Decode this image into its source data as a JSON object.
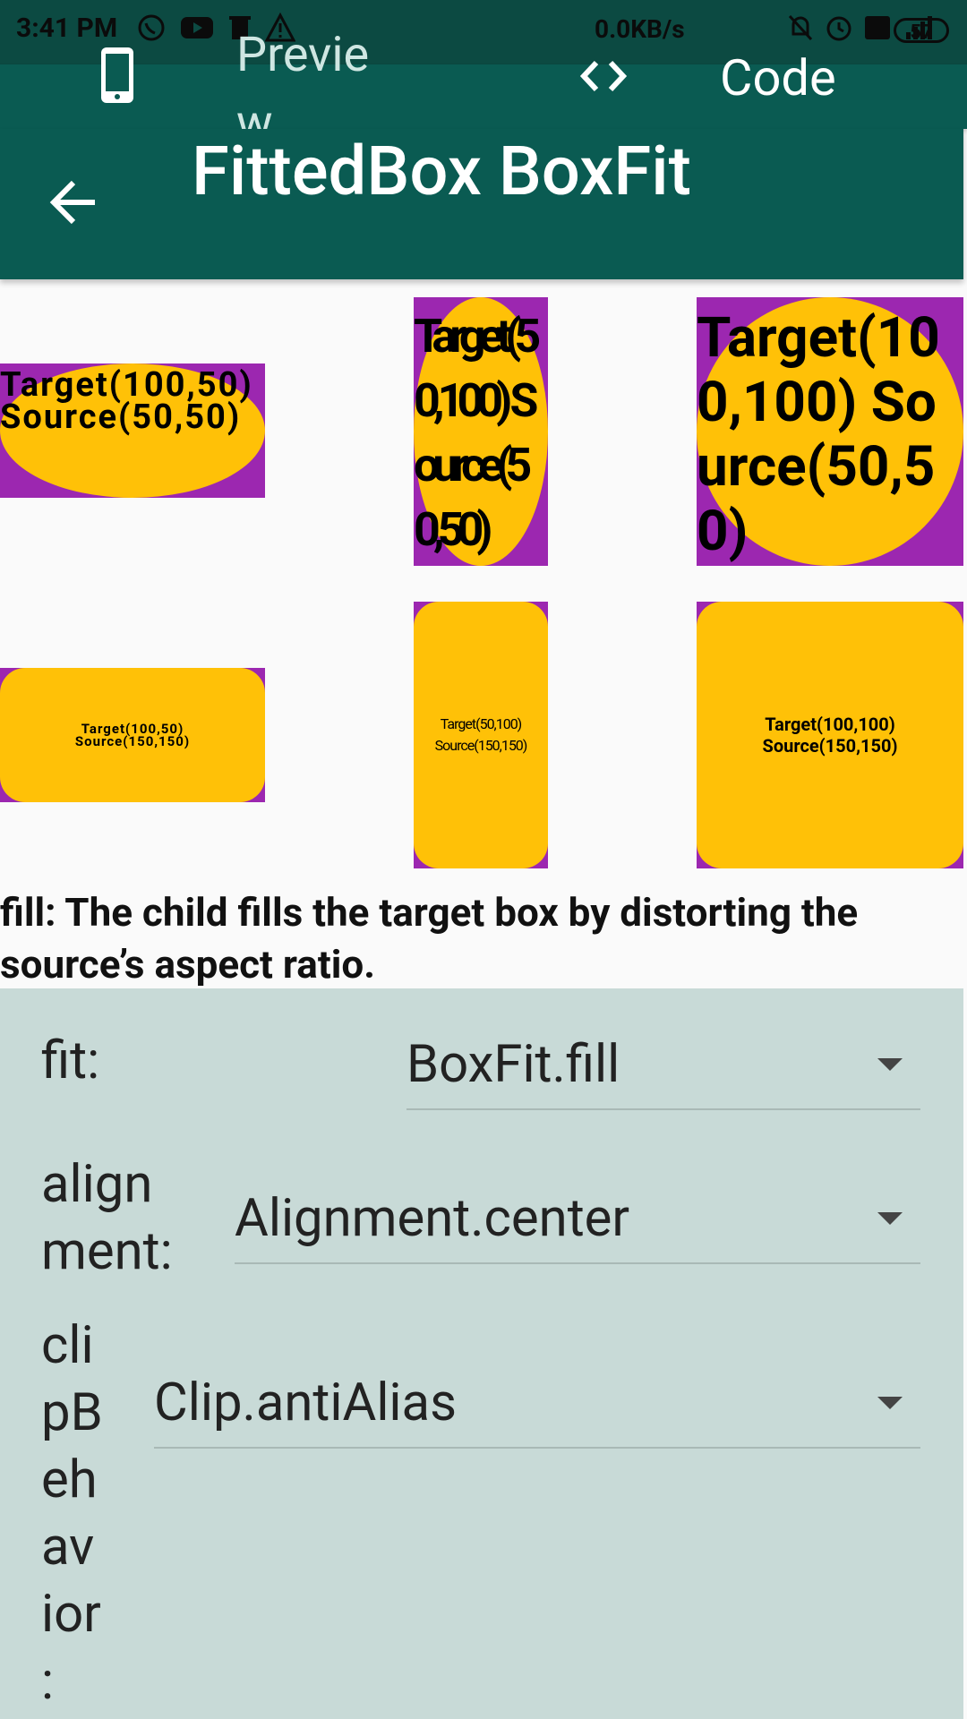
{
  "status_bar": {
    "time": "3:41 PM",
    "network_speed": "0.0KB/s",
    "battery": "57",
    "icons_left": [
      "whatsapp-icon",
      "youtube-icon",
      "delete-icon",
      "warning-icon"
    ],
    "icons_right": [
      "mute-icon",
      "alarm-icon",
      "volte-icon",
      "signal-icon"
    ]
  },
  "tabs": {
    "preview_label": "Previe w",
    "code_label": "Code"
  },
  "app_bar": {
    "title": "FittedBox BoxFit"
  },
  "demo": {
    "row1": [
      {
        "text": "Target(100,50) Source(50,50)"
      },
      {
        "text": "Target(50,100) Source(50,50)"
      },
      {
        "text": "Target(100,100) Source(50,50)"
      }
    ],
    "row2": [
      {
        "text": "Target(100,50) Source(150,150)"
      },
      {
        "text": "Target(50,100) Source(150,150)"
      },
      {
        "text": "Target(100,100) Source(150,150)"
      }
    ],
    "colors": {
      "box": "#9c27b0",
      "shape": "#ffc107"
    }
  },
  "description": "fill: The child fills the target box by distorting the source’s aspect ratio.",
  "controls": {
    "fit": {
      "label": "fit:",
      "value": "BoxFit.fill"
    },
    "alignment": {
      "label": "align ment:",
      "value": "Alignment.center"
    },
    "clip": {
      "label": "cli pB eh av ior :",
      "value": "Clip.antiAlias"
    }
  },
  "colors": {
    "primary": "#0a5b52",
    "panel": "#c8dad7"
  }
}
